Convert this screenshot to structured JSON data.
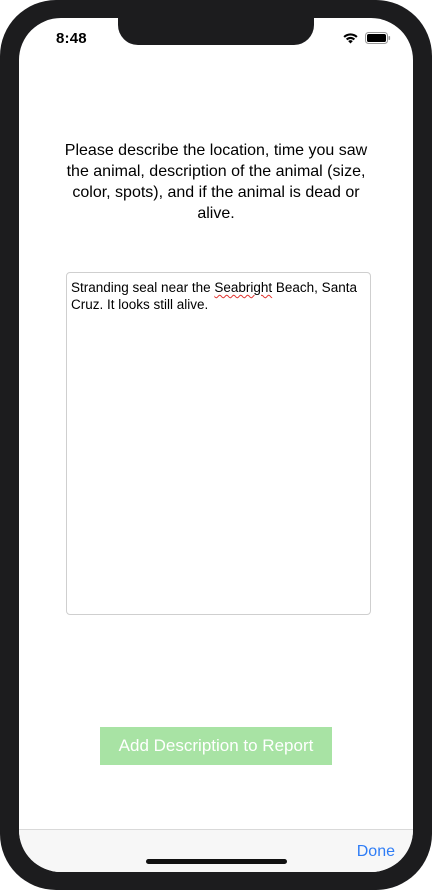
{
  "status_bar": {
    "time": "8:48",
    "icons": [
      "wifi-icon",
      "battery-icon"
    ]
  },
  "instructions": {
    "text": "Please describe the location, time you saw the animal, description of the animal (size, color, spots), and if the animal is dead or alive."
  },
  "description_field": {
    "value_before": "Stranding seal near the ",
    "value_misspelled": "Seabright",
    "value_after": " Beach, Santa Cruz. It looks still alive."
  },
  "add_button": {
    "label": "Add Description to Report",
    "color": "#a8e3a4"
  },
  "keyboard_toolbar": {
    "done_label": "Done",
    "accent": "#2f7df6"
  }
}
